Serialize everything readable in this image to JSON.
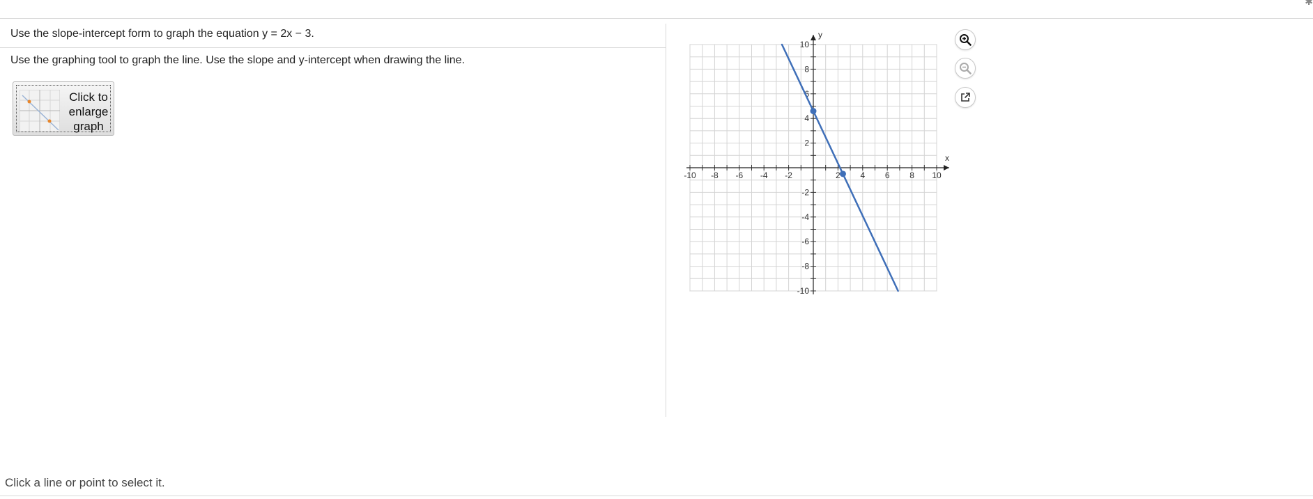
{
  "question": {
    "prompt": "Use the slope-intercept form to graph the equation y = 2x − 3.",
    "instruction": "Use the graphing tool to graph the line.  Use the slope and y-intercept when drawing the line."
  },
  "enlarge_button": {
    "label": "Click to\nenlarge\ngraph"
  },
  "graph": {
    "x_axis_label": "x",
    "y_axis_label": "y",
    "x_ticks": [
      "-10",
      "-8",
      "-6",
      "-4",
      "-2",
      "2",
      "4",
      "6",
      "8",
      "10"
    ],
    "y_ticks": [
      "10",
      "8",
      "6",
      "4",
      "2",
      "-2",
      "-4",
      "-6",
      "-8",
      "-10"
    ],
    "xlim": [
      -10,
      10
    ],
    "ylim": [
      -10,
      10
    ],
    "grid": true,
    "line_color": "#3f6fb8",
    "line": {
      "point_a": [
        0,
        4.6
      ],
      "point_b": [
        2.4,
        -0.5
      ]
    }
  },
  "tools": {
    "zoom_in": "zoom-in-icon",
    "zoom_out": "zoom-out-icon",
    "popout": "external-link-icon"
  },
  "status": {
    "text": "Click a line or point to select it."
  }
}
